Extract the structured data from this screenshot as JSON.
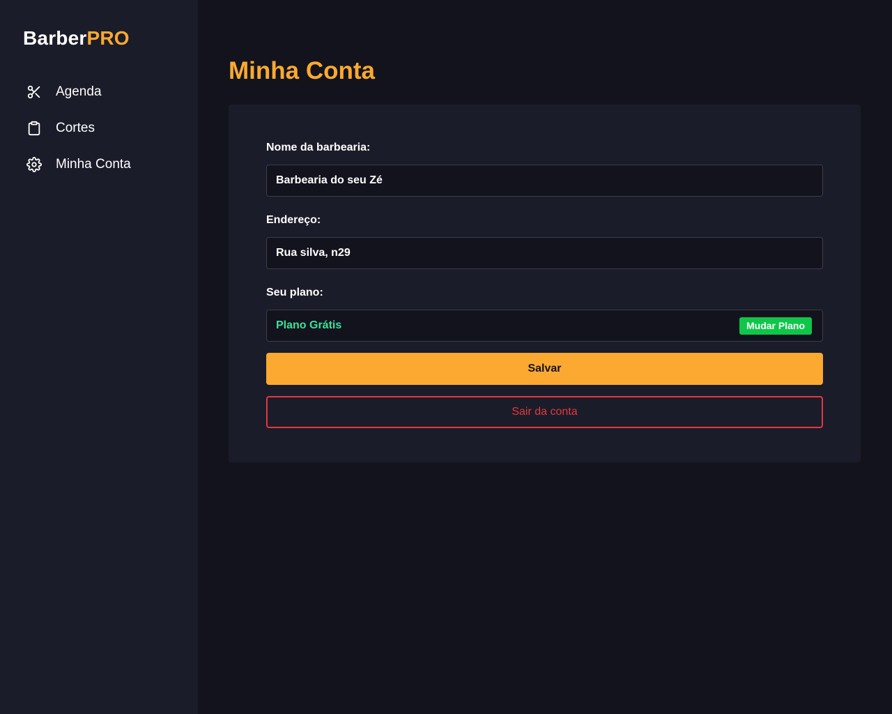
{
  "brand": {
    "part1": "Barber",
    "part2": "PRO"
  },
  "sidebar": {
    "items": [
      {
        "label": "Agenda",
        "icon": "scissors-icon"
      },
      {
        "label": "Cortes",
        "icon": "clipboard-icon"
      },
      {
        "label": "Minha Conta",
        "icon": "gear-icon"
      }
    ]
  },
  "page": {
    "title": "Minha Conta"
  },
  "form": {
    "name_label": "Nome da barbearia:",
    "name_value": "Barbearia do seu Zé",
    "address_label": "Endereço:",
    "address_value": "Rua  silva, n29",
    "plan_label": "Seu plano:",
    "plan_value": "Plano Grátis",
    "change_plan_label": "Mudar Plano",
    "save_label": "Salvar",
    "logout_label": "Sair da conta"
  },
  "colors": {
    "accent": "#fba931",
    "plan_green": "#38e39b",
    "button_green": "#0ec649",
    "danger": "#e5383f",
    "background": "#13131d",
    "panel": "#1b1c29"
  }
}
